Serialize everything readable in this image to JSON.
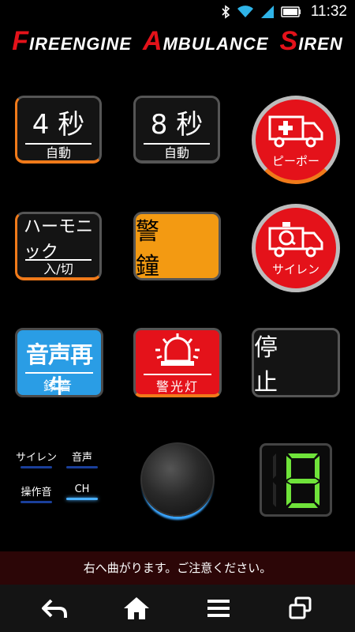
{
  "status": {
    "time": "11:32"
  },
  "app": {
    "title": [
      "F",
      "IREENGINE",
      "A",
      "MBULANCE",
      "S",
      "IREN"
    ]
  },
  "buttons": {
    "four_sec": {
      "main": "4 秒",
      "sub": "自動"
    },
    "eight_sec": {
      "main": "8 秒",
      "sub": "自動"
    },
    "pipo": {
      "label": "ピーポー"
    },
    "harmonic": {
      "main": "ハーモニック",
      "sub": "入/切"
    },
    "gong": {
      "label": "警 鐘"
    },
    "siren": {
      "label": "サイレン"
    },
    "playback": {
      "main": "音声再生",
      "sub": "録音"
    },
    "warning_light": {
      "label": "警光灯"
    },
    "stop": {
      "label": "停 止"
    }
  },
  "indicators": {
    "siren": "サイレン",
    "voice": "音声",
    "operation_sound": "操作音",
    "channel": "CH"
  },
  "counter": {
    "value": "8",
    "color": "#6fe33a"
  },
  "message": "右へ曲がります。ご注意ください。",
  "colors": {
    "accent_red": "#e4121a",
    "orange": "#f07a1a",
    "gong": "#f39a12",
    "blue": "#2a9de5"
  }
}
